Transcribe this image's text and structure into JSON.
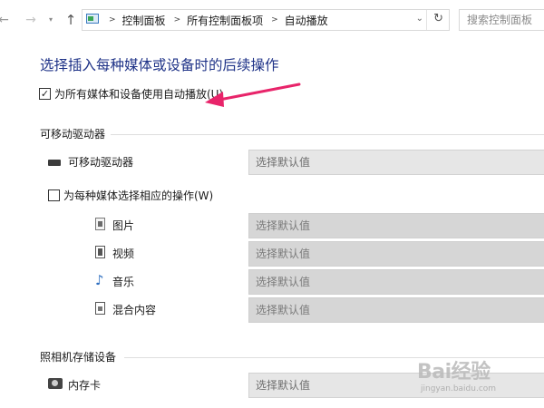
{
  "address_bar": {
    "breadcrumbs": [
      "控制面板",
      "所有控制面板项",
      "自动播放"
    ],
    "search_placeholder": "搜索控制面板"
  },
  "page_title": "选择插入每种媒体或设备时的后续操作",
  "autoplay_checkbox": {
    "label": "为所有媒体和设备使用自动播放(U)",
    "checked": true
  },
  "sections": {
    "removable": {
      "title": "可移动驱动器",
      "drive_label": "可移动驱动器",
      "drive_value": "选择默认值",
      "per_media_checkbox": {
        "label": "为每种媒体选择相应的操作(W)",
        "checked": false
      },
      "media_items": [
        {
          "label": "图片",
          "value": "选择默认值",
          "icon": "picture-icon"
        },
        {
          "label": "视频",
          "value": "选择默认值",
          "icon": "video-icon"
        },
        {
          "label": "音乐",
          "value": "选择默认值",
          "icon": "music-icon"
        },
        {
          "label": "混合内容",
          "value": "选择默认值",
          "icon": "mixed-content-icon"
        }
      ]
    },
    "camera": {
      "title": "照相机存储设备",
      "card_label": "内存卡",
      "card_value": "选择默认值"
    }
  },
  "watermark": {
    "main": "Bai经验",
    "sub": "jingyan.baidu.com"
  },
  "colors": {
    "title_blue": "#1e3287",
    "annotation_arrow": "#e8246a"
  }
}
